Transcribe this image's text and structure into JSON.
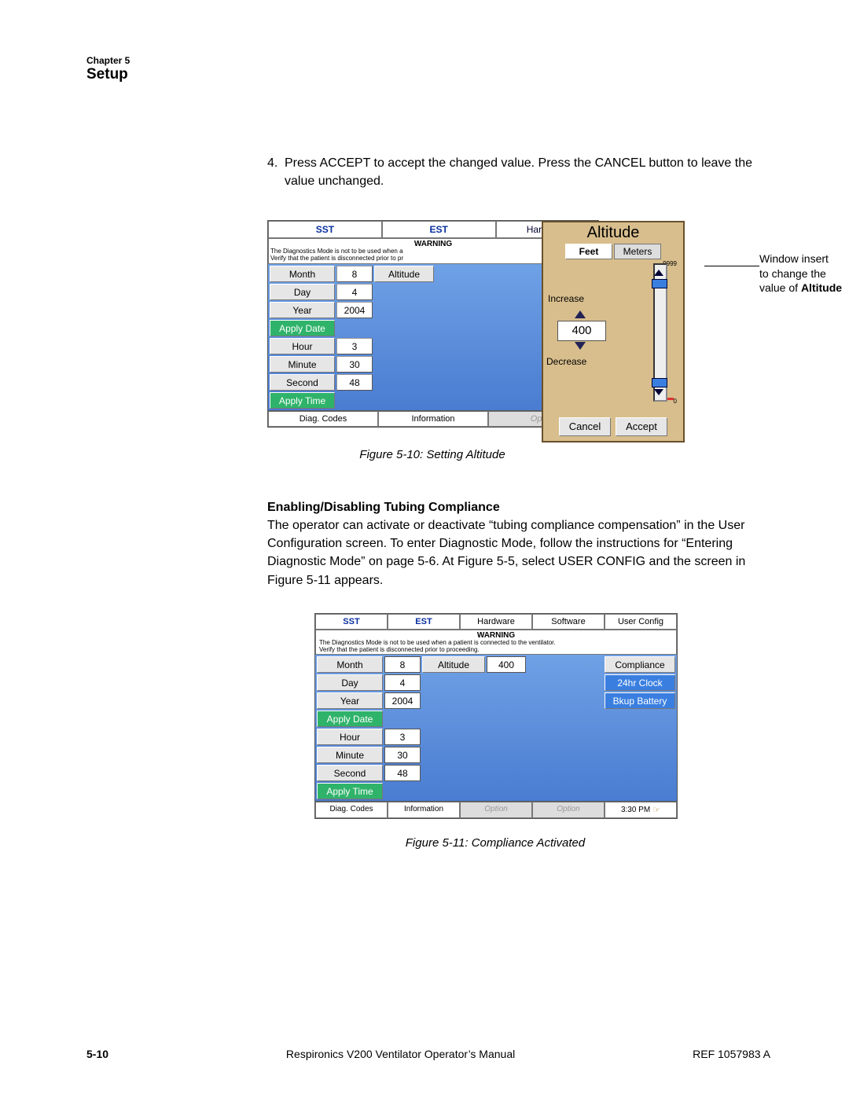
{
  "header": {
    "chapter": "Chapter 5",
    "title": "Setup"
  },
  "step4": {
    "number": "4.",
    "text": "Press ACCEPT to accept the changed value. Press the CANCEL button to leave the value unchanged."
  },
  "annotation": {
    "line1": "Window insert",
    "line2": "to change the",
    "line3_prefix": "value of ",
    "line3_bold": "Altitude"
  },
  "screen1": {
    "tabs": {
      "sst": "SST",
      "est": "EST",
      "hardware": "Hardware"
    },
    "warning": {
      "heading": "WARNING",
      "line1": "The Diagnostics Mode is not to be used when a",
      "line2": "Verify that the patient is disconnected prior to pr"
    },
    "labels": {
      "month": "Month",
      "day": "Day",
      "year": "Year",
      "applyDate": "Apply Date",
      "hour": "Hour",
      "minute": "Minute",
      "second": "Second",
      "applyTime": "Apply Time",
      "altitude": "Altitude"
    },
    "values": {
      "month": "8",
      "day": "4",
      "year": "2004",
      "hour": "3",
      "minute": "30",
      "second": "48"
    },
    "bottomTabs": {
      "diag": "Diag. Codes",
      "info": "Information",
      "option": "Option"
    }
  },
  "popup": {
    "title": "Altitude",
    "units": {
      "feet": "Feet",
      "meters": "Meters"
    },
    "increase": "Increase",
    "decrease": "Decrease",
    "value": "400",
    "max": "9999",
    "min": "0",
    "cancel": "Cancel",
    "accept": "Accept"
  },
  "caption1": "Figure 5-10: Setting Altitude",
  "subhead": "Enabling/Disabling Tubing Compliance",
  "para": "The operator can activate or deactivate “tubing compliance compensation” in the User Configuration screen. To enter Diagnostic Mode, follow the instructions for “Entering Diagnostic Mode” on page 5-6. At Figure 5-5, select USER CONFIG and the screen in Figure 5-11 appears.",
  "screen2": {
    "tabs": {
      "sst": "SST",
      "est": "EST",
      "hardware": "Hardware",
      "software": "Software",
      "userConfig": "User Config"
    },
    "warning": {
      "heading": "WARNING",
      "line1": "The Diagnostics Mode is not to be used when a patient is connected to the ventilator.",
      "line2": "Verify that the patient is disconnected prior to proceeding."
    },
    "labels": {
      "month": "Month",
      "day": "Day",
      "year": "Year",
      "applyDate": "Apply Date",
      "hour": "Hour",
      "minute": "Minute",
      "second": "Second",
      "applyTime": "Apply Time",
      "altitude": "Altitude",
      "compliance": "Compliance",
      "clock": "24hr Clock",
      "battery": "Bkup Battery"
    },
    "values": {
      "month": "8",
      "day": "4",
      "year": "2004",
      "hour": "3",
      "minute": "30",
      "second": "48",
      "altitude": "400"
    },
    "bottomTabs": {
      "diag": "Diag. Codes",
      "info": "Information",
      "option1": "Option",
      "option2": "Option",
      "time": "3:30 PM"
    }
  },
  "caption2": "Figure 5-11: Compliance Activated",
  "footer": {
    "pageNum": "5-10",
    "center": "Respironics V200 Ventilator Operator’s Manual",
    "ref": "REF 1057983 A"
  }
}
